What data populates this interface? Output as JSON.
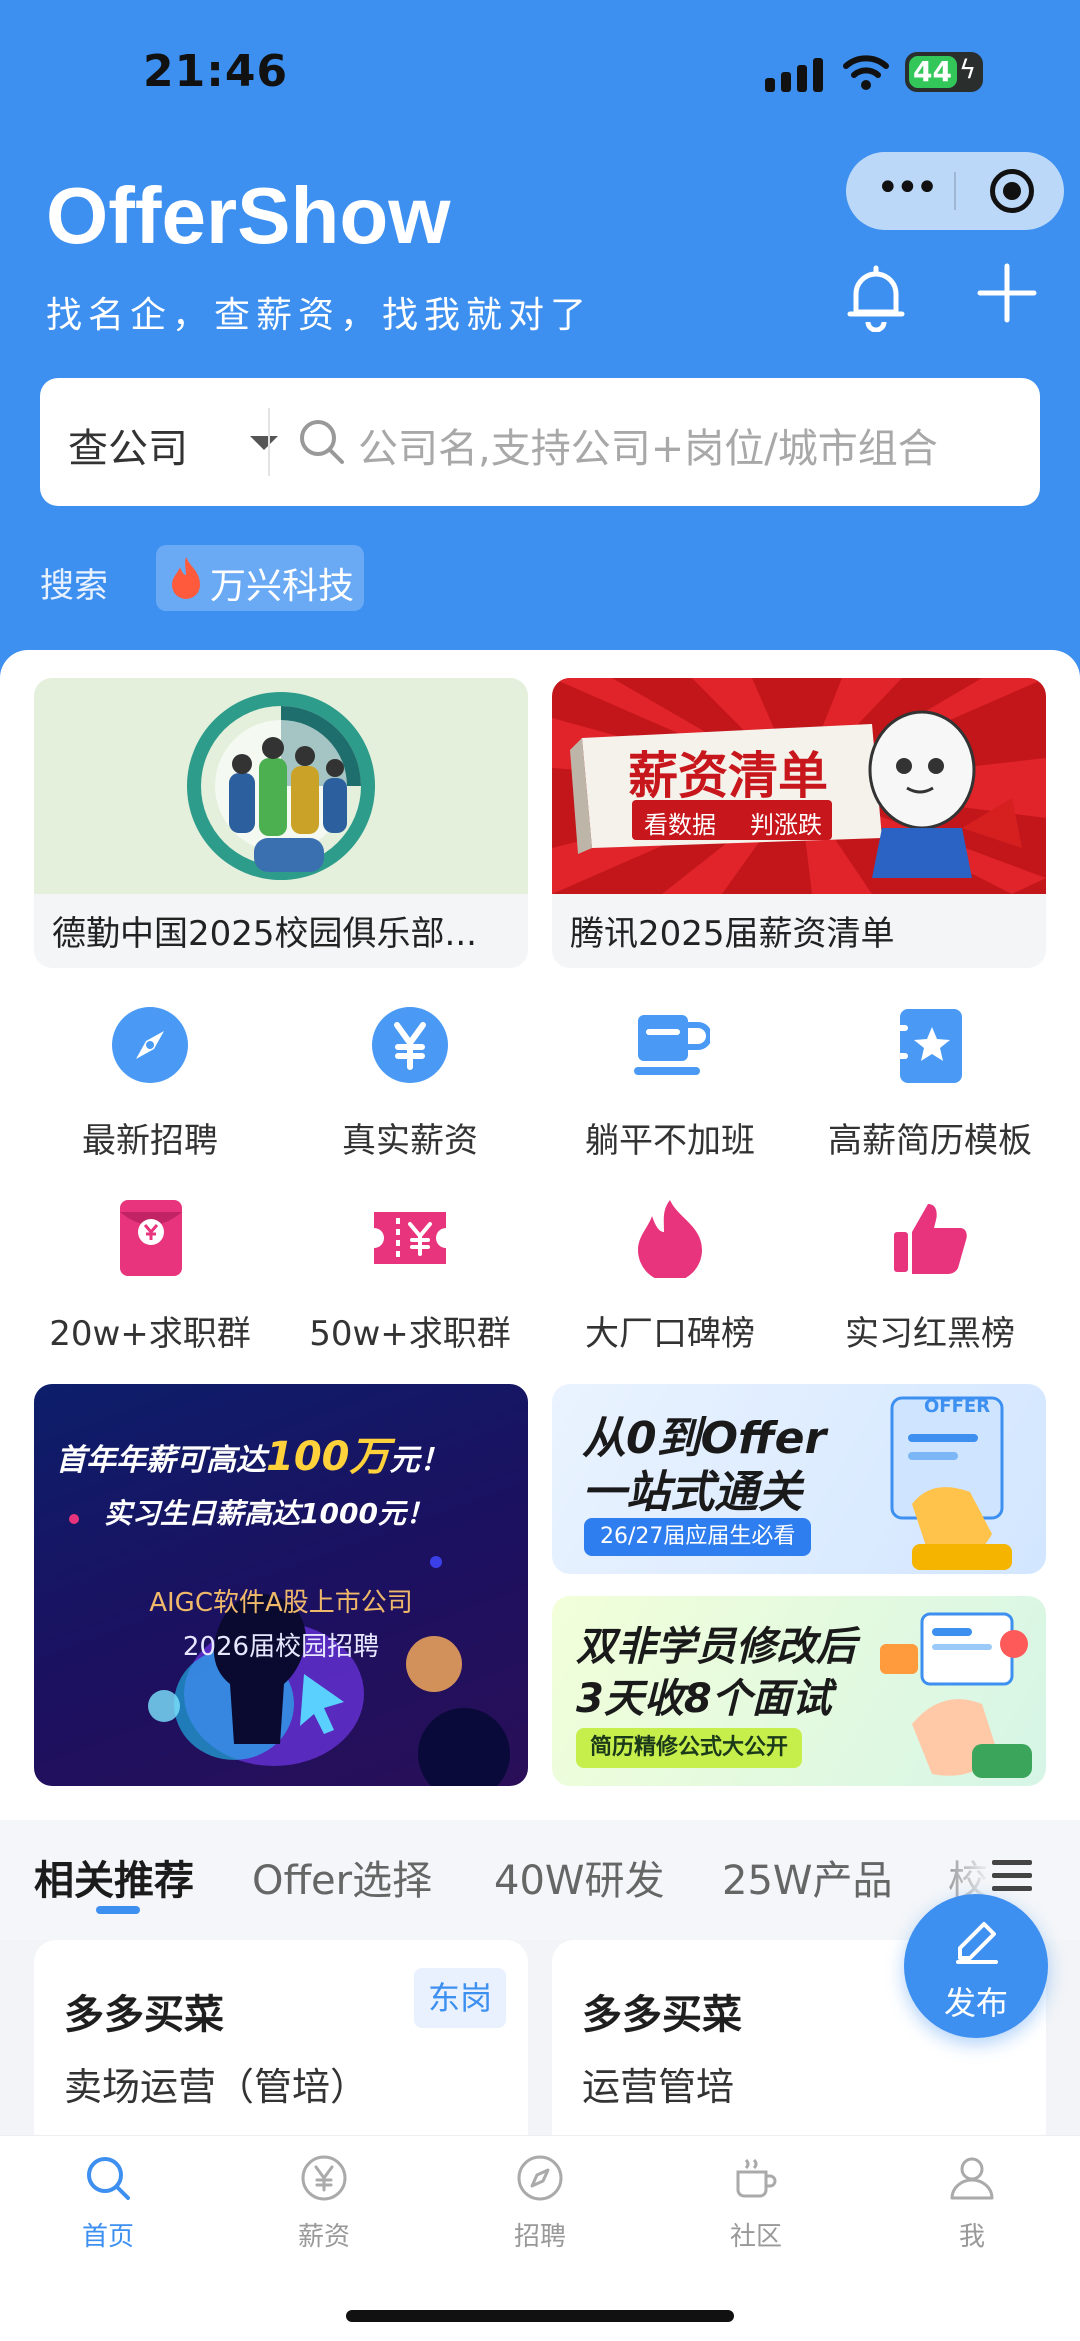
{
  "status_bar": {
    "time": "21:46",
    "battery": "44"
  },
  "header": {
    "title": "OfferShow",
    "subtitle": "找名企，查薪资，找我就对了"
  },
  "search": {
    "type_label": "查公司",
    "placeholder": "公司名,支持公司+岗位/城市组合",
    "hot_label": "搜索",
    "hot_keyword": "万兴科技"
  },
  "promos": [
    {
      "caption": "德勤中国2025校园俱乐部..."
    },
    {
      "caption": "腾讯2025届薪资清单",
      "banner_title": "薪资清单",
      "banner_sub1": "看数据",
      "banner_sub2": "判涨跌"
    }
  ],
  "grid": [
    {
      "label": "最新招聘",
      "icon": "compass-icon",
      "color": "#4a9af5"
    },
    {
      "label": "真实薪资",
      "icon": "yen-icon",
      "color": "#4a9af5"
    },
    {
      "label": "躺平不加班",
      "icon": "cup-icon",
      "color": "#4a9af5"
    },
    {
      "label": "高薪简历模板",
      "icon": "resume-star-icon",
      "color": "#4a9af5"
    },
    {
      "label": "20w+求职群",
      "icon": "red-envelope-icon",
      "color": "#e8347c"
    },
    {
      "label": "50w+求职群",
      "icon": "ticket-icon",
      "color": "#e8347c"
    },
    {
      "label": "大厂口碑榜",
      "icon": "flame-icon",
      "color": "#e8347c"
    },
    {
      "label": "实习红黑榜",
      "icon": "thumbs-up-icon",
      "color": "#e8347c"
    }
  ],
  "banners": {
    "left": {
      "line1a": "首年年薪可高达",
      "line1b": "100万",
      "line1c": "元！",
      "line2": "实习生日薪高达1000元！",
      "line3": "AIGC软件A股上市公司",
      "line4": "2026届校园招聘"
    },
    "right_top": {
      "line1": "从0到Offer",
      "line2": "一站式通关",
      "pill": "26/27届应届生必看",
      "badge": "OFFER"
    },
    "right_bottom": {
      "line1": "双非学员修改后",
      "line2": "3天收8个面试",
      "pill": "简历精修公式大公开"
    }
  },
  "feed_tabs": [
    "相关推荐",
    "Offer选择",
    "40W研发",
    "25W产品",
    "校"
  ],
  "cards": [
    {
      "company": "多多买菜",
      "role": "卖场运营（管培）",
      "tag": "东岗"
    },
    {
      "company": "多多买菜",
      "role": "运营管培"
    }
  ],
  "fab": {
    "label": "发布"
  },
  "bottom_nav": [
    {
      "label": "首页",
      "icon": "search-icon",
      "active": true
    },
    {
      "label": "薪资",
      "icon": "yen-circle-icon",
      "active": false
    },
    {
      "label": "招聘",
      "icon": "compass-icon",
      "active": false
    },
    {
      "label": "社区",
      "icon": "coffee-cup-icon",
      "active": false
    },
    {
      "label": "我",
      "icon": "person-icon",
      "active": false
    }
  ],
  "colors": {
    "brand_blue": "#3d8ff0",
    "accent_pink": "#e8347c"
  }
}
